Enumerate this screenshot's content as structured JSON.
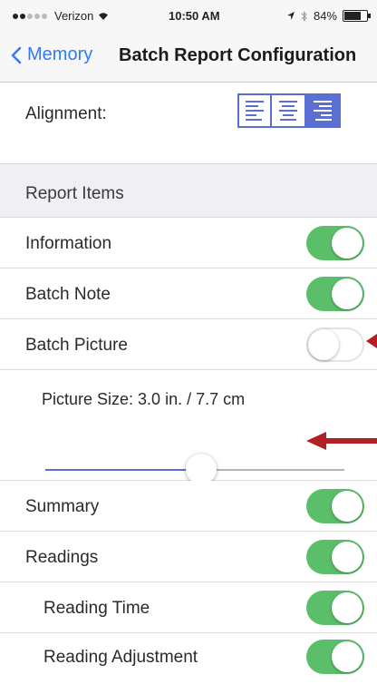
{
  "status_bar": {
    "carrier": "Verizon",
    "time": "10:50 AM",
    "battery": "84%",
    "battery_level": 0.84
  },
  "nav": {
    "back_label": "Memory",
    "title": "Batch Report Configuration"
  },
  "alignment": {
    "label": "Alignment:",
    "options": [
      "align-left",
      "align-center",
      "align-right"
    ],
    "selected": "align-right"
  },
  "report_items": {
    "header": "Report Items",
    "items": [
      {
        "label": "Information",
        "on": true
      },
      {
        "label": "Batch Note",
        "on": true
      },
      {
        "label": "Batch Picture",
        "on": false
      }
    ],
    "picture_size": {
      "label": "Picture Size: 3.0 in. / 7.7 cm",
      "slider_fraction": 0.52
    },
    "items_after": [
      {
        "label": "Summary",
        "on": true
      },
      {
        "label": "Readings",
        "on": true
      },
      {
        "label": "Reading Time",
        "on": true
      },
      {
        "label": "Reading Adjustment",
        "on": true
      }
    ]
  },
  "colors": {
    "accent": "#3478f6",
    "toggle_on": "#5bbf6a",
    "segment": "#5a6fd0",
    "annotation_arrow": "#b21f24"
  }
}
